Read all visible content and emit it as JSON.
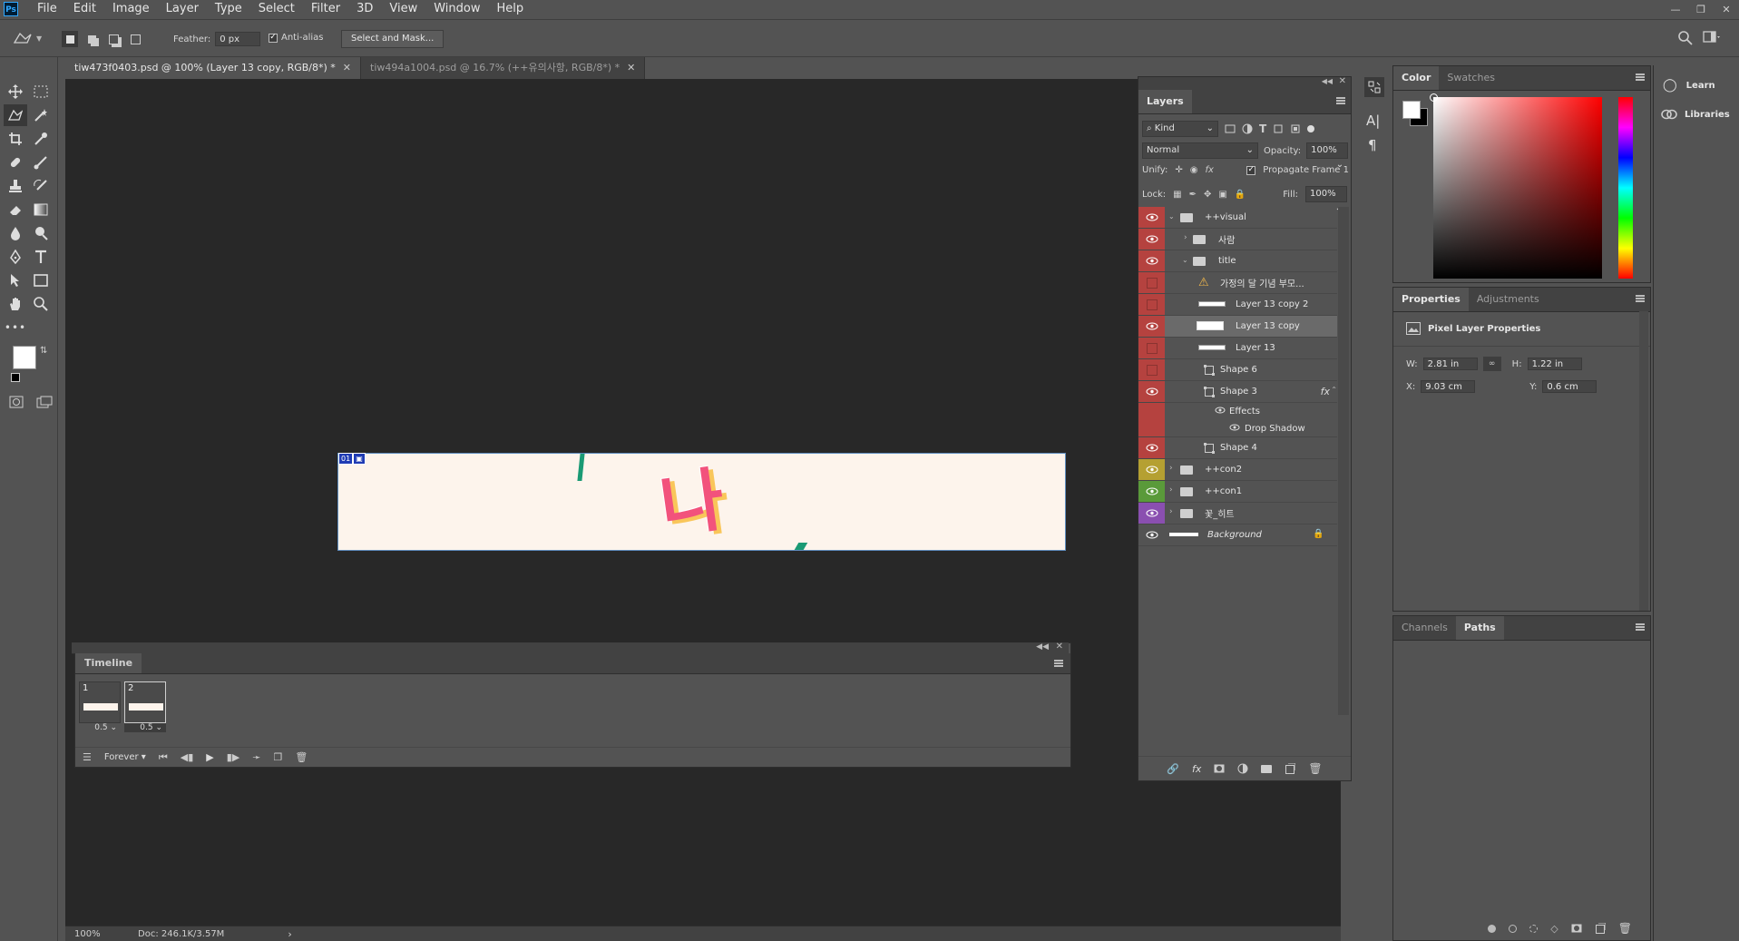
{
  "app": {
    "logo": "Ps"
  },
  "menubar": {
    "items": [
      "File",
      "Edit",
      "Image",
      "Layer",
      "Type",
      "Select",
      "Filter",
      "3D",
      "View",
      "Window",
      "Help"
    ]
  },
  "options": {
    "feather_label": "Feather:",
    "feather_value": "0 px",
    "antialias_label": "Anti-alias",
    "select_mask_label": "Select and Mask..."
  },
  "tabs": [
    {
      "title": "tiw473f0403.psd @ 100% (Layer 13 copy, RGB/8*) *",
      "active": true
    },
    {
      "title": "tiw494a1004.psd @ 16.7% (++유의사항, RGB/8*) *",
      "active": false
    }
  ],
  "canvas": {
    "artwork_text": "나",
    "frame_badge": "01"
  },
  "timeline": {
    "title": "Timeline",
    "frames": [
      {
        "num": "1",
        "delay": "0.5"
      },
      {
        "num": "2",
        "delay": "0.5"
      }
    ],
    "loop": "Forever"
  },
  "layers": {
    "title": "Layers",
    "filter": "Kind",
    "blend": "Normal",
    "opacity_label": "Opacity:",
    "opacity": "100%",
    "unify_label": "Unify:",
    "propagate_label": "Propagate Frame 1",
    "lock_label": "Lock:",
    "fill_label": "Fill:",
    "fill": "100%",
    "rows": [
      {
        "name": "++visual",
        "color": "#b5423f",
        "vis": true
      },
      {
        "name": "사람",
        "color": "#b5423f",
        "vis": true
      },
      {
        "name": "title",
        "color": "#b5423f",
        "vis": true
      },
      {
        "name": "가정의 달 기념 부모...",
        "color": "#b5423f",
        "vis": false
      },
      {
        "name": "Layer 13 copy 2",
        "color": "#b5423f",
        "vis": false
      },
      {
        "name": "Layer 13 copy",
        "color": "#b5423f",
        "vis": true
      },
      {
        "name": "Layer 13",
        "color": "#b5423f",
        "vis": false
      },
      {
        "name": "Shape 6",
        "color": "#b5423f",
        "vis": false
      },
      {
        "name": "Shape 3",
        "color": "#b5423f",
        "vis": true
      },
      {
        "name": "Effects",
        "color": "#b5423f",
        "vis": false
      },
      {
        "name": "Drop Shadow",
        "color": "#b5423f",
        "vis": false
      },
      {
        "name": "Shape 4",
        "color": "#b5423f",
        "vis": true
      },
      {
        "name": "++con2",
        "color": "#b5a032",
        "vis": true
      },
      {
        "name": "++con1",
        "color": "#5a9a3a",
        "vis": true
      },
      {
        "name": "꽃_히트",
        "color": "#8a4fb0",
        "vis": true
      },
      {
        "name": "Background",
        "color": "#535353",
        "vis": true
      }
    ]
  },
  "color": {
    "tabs": [
      "Color",
      "Swatches"
    ]
  },
  "properties": {
    "tabs": [
      "Properties",
      "Adjustments"
    ],
    "section": "Pixel Layer Properties",
    "w_label": "W:",
    "w": "2.81 in",
    "h_label": "H:",
    "h": "1.22 in",
    "x_label": "X:",
    "x": "9.03 cm",
    "y_label": "Y:",
    "y": "0.6 cm"
  },
  "paths": {
    "tabs": [
      "Channels",
      "Paths"
    ]
  },
  "learn": {
    "learn_label": "Learn",
    "libraries_label": "Libraries"
  },
  "status": {
    "zoom": "100%",
    "doc": "Doc: 246.1K/3.57M"
  }
}
